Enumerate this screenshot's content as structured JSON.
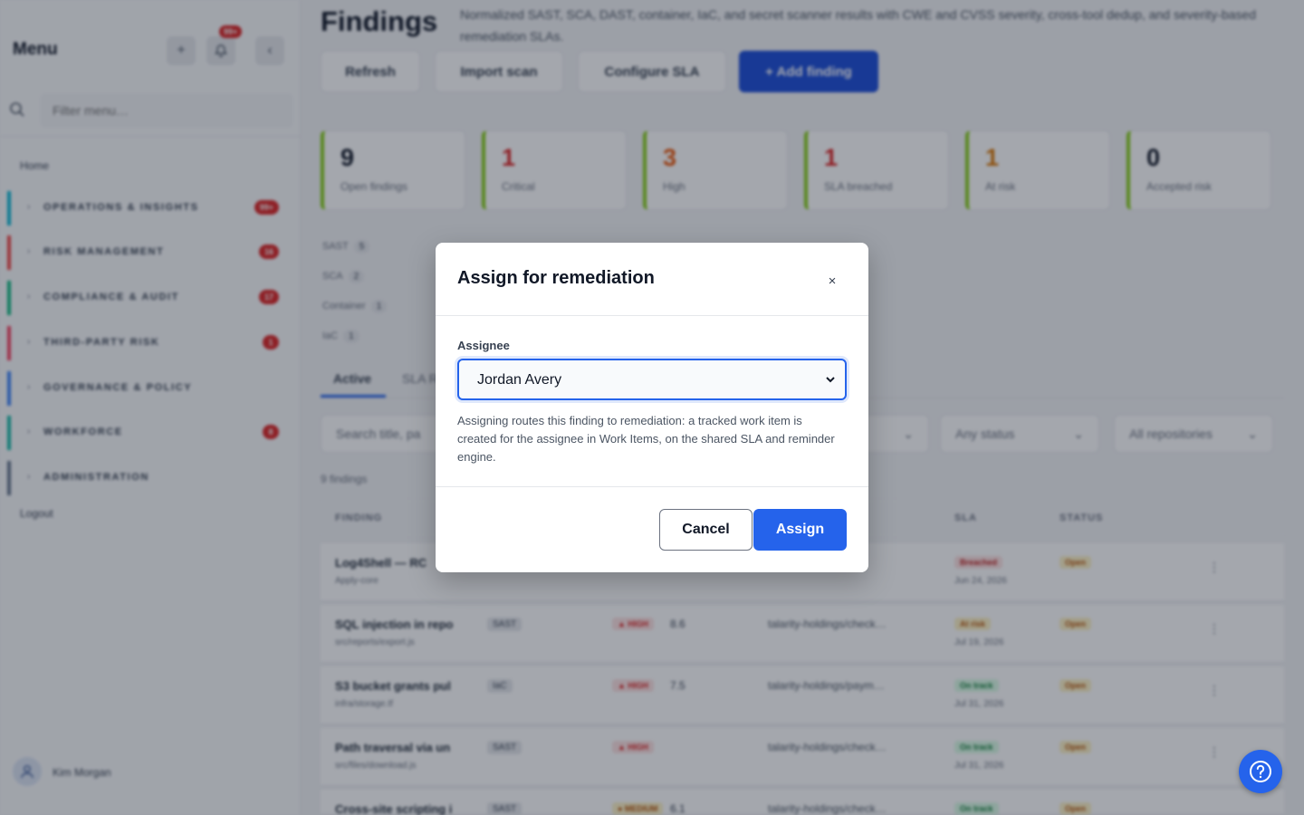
{
  "sidebar": {
    "title": "Menu",
    "notifications_badge": "99+",
    "filter_placeholder": "Filter menu…",
    "home": "Home",
    "items": [
      {
        "label": "OPERATIONS & INSIGHTS",
        "count": "99+",
        "color": "#06b6d4"
      },
      {
        "label": "RISK MANAGEMENT",
        "count": "16",
        "color": "#ef4444"
      },
      {
        "label": "COMPLIANCE & AUDIT",
        "count": "17",
        "color": "#10b981"
      },
      {
        "label": "THIRD-PARTY RISK",
        "count": "1",
        "color": "#f43f5e"
      },
      {
        "label": "GOVERNANCE & POLICY",
        "count": "",
        "color": "#3b82f6"
      },
      {
        "label": "WORKFORCE",
        "count": "8",
        "color": "#14b8a6"
      },
      {
        "label": "ADMINISTRATION",
        "count": "",
        "color": "#64748b"
      }
    ],
    "logout": "Logout",
    "user_name": "Kim Morgan"
  },
  "header": {
    "title": "Findings",
    "description": "Normalized SAST, SCA, DAST, container, IaC, and secret scanner results with CWE and CVSS severity, cross-tool dedup, and severity-based remediation SLAs.",
    "buttons": {
      "refresh": "Refresh",
      "import": "Import scan",
      "configure": "Configure SLA",
      "add": "+ Add finding"
    }
  },
  "kpis": [
    {
      "value": "9",
      "label": "Open findings",
      "color": "#111827"
    },
    {
      "value": "1",
      "label": "Critical",
      "color": "#dc2626"
    },
    {
      "value": "3",
      "label": "High",
      "color": "#ea580c"
    },
    {
      "value": "1",
      "label": "SLA breached",
      "color": "#dc2626"
    },
    {
      "value": "1",
      "label": "At risk",
      "color": "#d97706"
    },
    {
      "value": "0",
      "label": "Accepted risk",
      "color": "#111827"
    }
  ],
  "source_chips": [
    {
      "name": "SAST",
      "count": "5"
    },
    {
      "name": "SCA",
      "count": "2"
    },
    {
      "name": "Container",
      "count": "1"
    },
    {
      "name": "IaC",
      "count": "1"
    }
  ],
  "tabs": {
    "active": "Active",
    "sla": "SLA R"
  },
  "filters": {
    "search_placeholder": "Search title, pa",
    "status": "Any status",
    "repo": "All repositories"
  },
  "count_label": "9 findings",
  "table": {
    "headers": {
      "finding": "FINDING",
      "sla": "SLA",
      "status": "STATUS"
    },
    "rows": [
      {
        "title": "Log4Shell — RC",
        "sub": "Apply-core",
        "src": "",
        "sev": "",
        "score": "",
        "repo": "",
        "sla": "Breached",
        "sla_bg": "#fee2e2",
        "sla_fg": "#b91c1c",
        "date": "Jun 24, 2026",
        "status": "Open"
      },
      {
        "title": "SQL injection in repo",
        "sub": "src/reports/export.js",
        "src": "SAST",
        "sev": "▲ HIGH",
        "score": "8.6",
        "repo": "talarity-holdings/check…",
        "sla": "At risk",
        "sla_bg": "#fef3c7",
        "sla_fg": "#b45309",
        "date": "Jul 19, 2026",
        "status": "Open"
      },
      {
        "title": "S3 bucket grants pul",
        "sub": "infra/storage.tf",
        "src": "IaC",
        "sev": "▲ HIGH",
        "score": "7.5",
        "repo": "talarity-holdings/paym…",
        "sla": "On track",
        "sla_bg": "#dcfce7",
        "sla_fg": "#15803d",
        "date": "Jul 31, 2026",
        "status": "Open"
      },
      {
        "title": "Path traversal via un",
        "sub": "src/files/download.js",
        "src": "SAST",
        "sev": "▲ HIGH",
        "score": "",
        "repo": "talarity-holdings/check…",
        "sla": "On track",
        "sla_bg": "#dcfce7",
        "sla_fg": "#15803d",
        "date": "Jul 31, 2026",
        "status": "Open"
      },
      {
        "title": "Cross-site scripting i",
        "sub": "",
        "src": "SAST",
        "sev": "● MEDIUM",
        "score": "6.1",
        "repo": "talarity-holdings/check…",
        "sla": "On track",
        "sla_bg": "#dcfce7",
        "sla_fg": "#15803d",
        "date": "",
        "status": "Open"
      }
    ]
  },
  "modal": {
    "title": "Assign for remediation",
    "close": "×",
    "assignee_label": "Assignee",
    "assignee_value": "Jordan Avery",
    "help": "Assigning routes this finding to remediation: a tracked work item is created for the assignee in Work Items, on the shared SLA and reminder engine.",
    "cancel": "Cancel",
    "assign": "Assign"
  },
  "colors": {
    "accent": "#2563eb",
    "primary_dark": "#1d4ed8",
    "danger": "#dc2626"
  }
}
